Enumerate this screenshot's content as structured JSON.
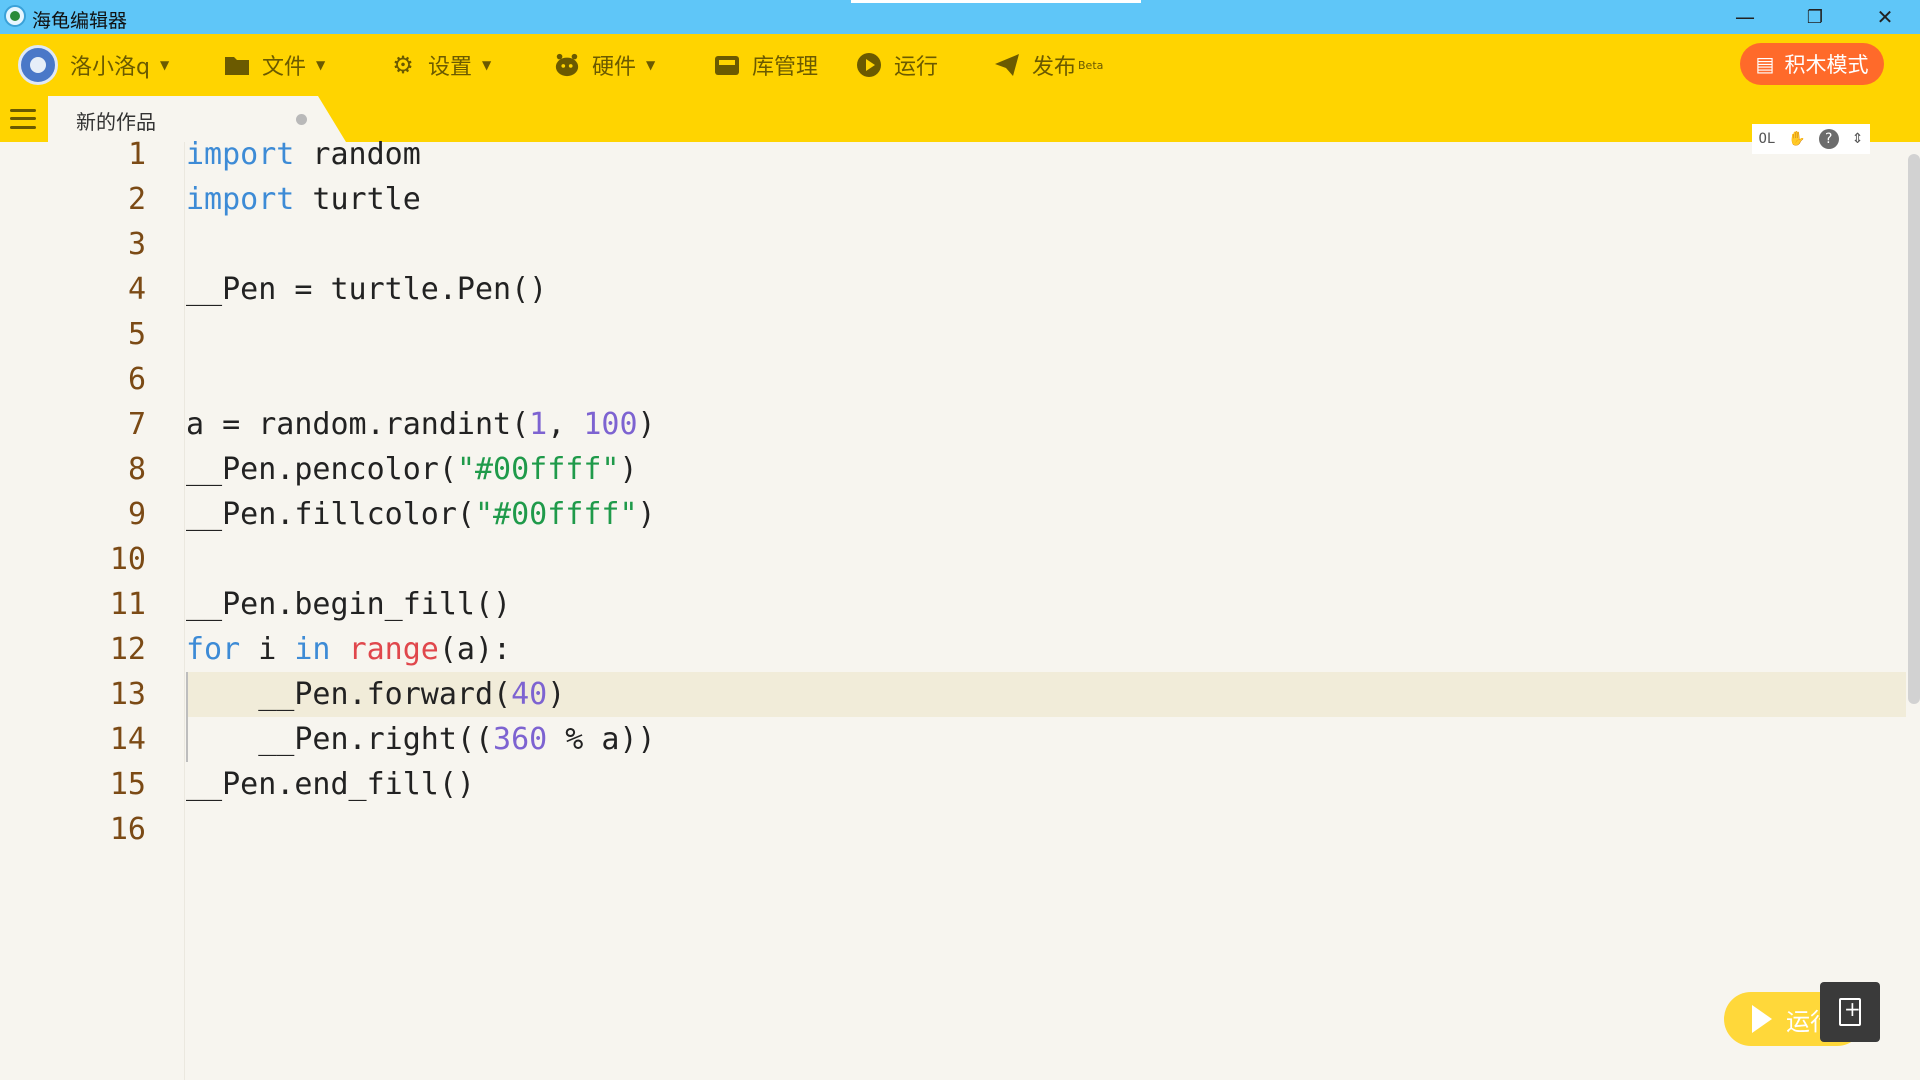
{
  "window": {
    "title": "海龟编辑器",
    "minimize": "—",
    "restore": "❐",
    "close": "✕"
  },
  "toolbar": {
    "user": "洛小洛q",
    "file": "文件",
    "settings": "设置",
    "hardware": "硬件",
    "library": "库管理",
    "run": "运行",
    "publish": "发布",
    "publish_badge": "Beta",
    "block_mode": "积木模式",
    "icons": {
      "file": "folder-icon",
      "settings": "gear-icon",
      "hardware": "robot-icon",
      "library": "box-icon",
      "run": "play-icon",
      "publish": "paper-plane-icon"
    },
    "accent_colors": {
      "toolbar": "#ffd400",
      "titlebar": "#5fc6f8",
      "block_mode": "#ff6a2a"
    }
  },
  "tabs": [
    {
      "label": "新的作品",
      "unsaved": true
    }
  ],
  "mini_tools": {
    "ol": "OL",
    "help": "?"
  },
  "editor": {
    "line_numbers": [
      "1",
      "2",
      "3",
      "4",
      "5",
      "6",
      "7",
      "8",
      "9",
      "10",
      "11",
      "12",
      "13",
      "14",
      "15",
      "16"
    ],
    "lines": [
      [
        {
          "t": "import",
          "c": "kw"
        },
        {
          "t": " random",
          "c": ""
        }
      ],
      [
        {
          "t": "import",
          "c": "kw"
        },
        {
          "t": " turtle",
          "c": ""
        }
      ],
      [],
      [
        {
          "t": "__Pen = turtle.Pen()",
          "c": ""
        }
      ],
      [],
      [],
      [
        {
          "t": "a = random.randint(",
          "c": ""
        },
        {
          "t": "1",
          "c": "num"
        },
        {
          "t": ", ",
          "c": ""
        },
        {
          "t": "100",
          "c": "num"
        },
        {
          "t": ")",
          "c": ""
        }
      ],
      [
        {
          "t": "__Pen.pencolor(",
          "c": ""
        },
        {
          "t": "\"#00ffff\"",
          "c": "str"
        },
        {
          "t": ")",
          "c": ""
        }
      ],
      [
        {
          "t": "__Pen.fillcolor(",
          "c": ""
        },
        {
          "t": "\"#00ffff\"",
          "c": "str"
        },
        {
          "t": ")",
          "c": ""
        }
      ],
      [],
      [
        {
          "t": "__Pen.begin_fill()",
          "c": ""
        }
      ],
      [
        {
          "t": "for",
          "c": "kw"
        },
        {
          "t": " i ",
          "c": ""
        },
        {
          "t": "in",
          "c": "kw"
        },
        {
          "t": " ",
          "c": ""
        },
        {
          "t": "range",
          "c": "bi"
        },
        {
          "t": "(a):",
          "c": ""
        }
      ],
      [
        {
          "t": "    __Pen.forward(",
          "c": ""
        },
        {
          "t": "40",
          "c": "num"
        },
        {
          "t": ")",
          "c": ""
        }
      ],
      [
        {
          "t": "    __Pen.right((",
          "c": ""
        },
        {
          "t": "360",
          "c": "num"
        },
        {
          "t": " % a))",
          "c": ""
        }
      ],
      [
        {
          "t": "__Pen.end_fill()",
          "c": ""
        }
      ],
      []
    ]
  },
  "run_button": {
    "label": "运行"
  }
}
